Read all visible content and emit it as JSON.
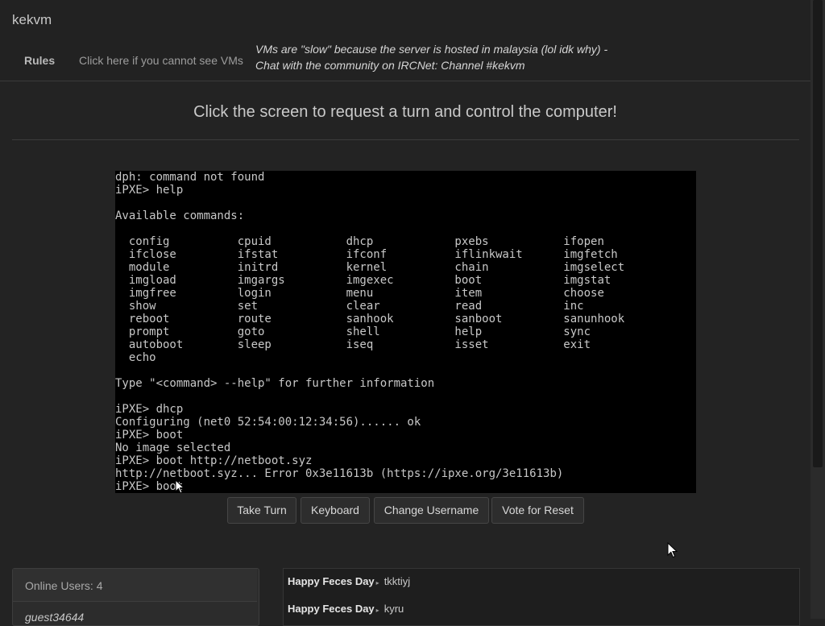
{
  "navbar": {
    "brand": "kekvm",
    "rules_label": "Rules",
    "cannot_see_label": "Click here if you cannot see VMs",
    "notice_line1": "VMs are \"slow\" because the server is hosted in malaysia (lol idk why) -",
    "notice_line2": "Chat with the community on IRCNet: Channel #kekvm"
  },
  "main": {
    "heading": "Click the screen to request a turn and control the computer!"
  },
  "terminal": {
    "lines": [
      "dph: command not found",
      "iPXE> help",
      "",
      "Available commands:",
      "",
      "  config          cpuid           dhcp            pxebs           ifopen",
      "  ifclose         ifstat          ifconf          iflinkwait      imgfetch",
      "  module          initrd          kernel          chain           imgselect",
      "  imgload         imgargs         imgexec         boot            imgstat",
      "  imgfree         login           menu            item            choose",
      "  show            set             clear           read            inc",
      "  reboot          route           sanhook         sanboot         sanunhook",
      "  prompt          goto            shell           help            sync",
      "  autoboot        sleep           iseq            isset           exit",
      "  echo",
      "",
      "Type \"<command> --help\" for further information",
      "",
      "iPXE> dhcp",
      "Configuring (net0 52:54:00:12:34:56)...... ok",
      "iPXE> boot",
      "No image selected",
      "iPXE> boot http://netboot.syz",
      "http://netboot.syz... Error 0x3e11613b (https://ipxe.org/3e11613b)",
      "iPXE> boot"
    ]
  },
  "buttons": {
    "take_turn": "Take Turn",
    "keyboard": "Keyboard",
    "change_username": "Change Username",
    "vote_reset": "Vote for Reset"
  },
  "users": {
    "header": "Online Users: 4",
    "list": [
      "guest34644"
    ]
  },
  "chat": {
    "messages": [
      {
        "user": "Happy Feces Day",
        "text": "tkktiyj"
      },
      {
        "user": "Happy Feces Day",
        "text": "kyru"
      }
    ]
  }
}
